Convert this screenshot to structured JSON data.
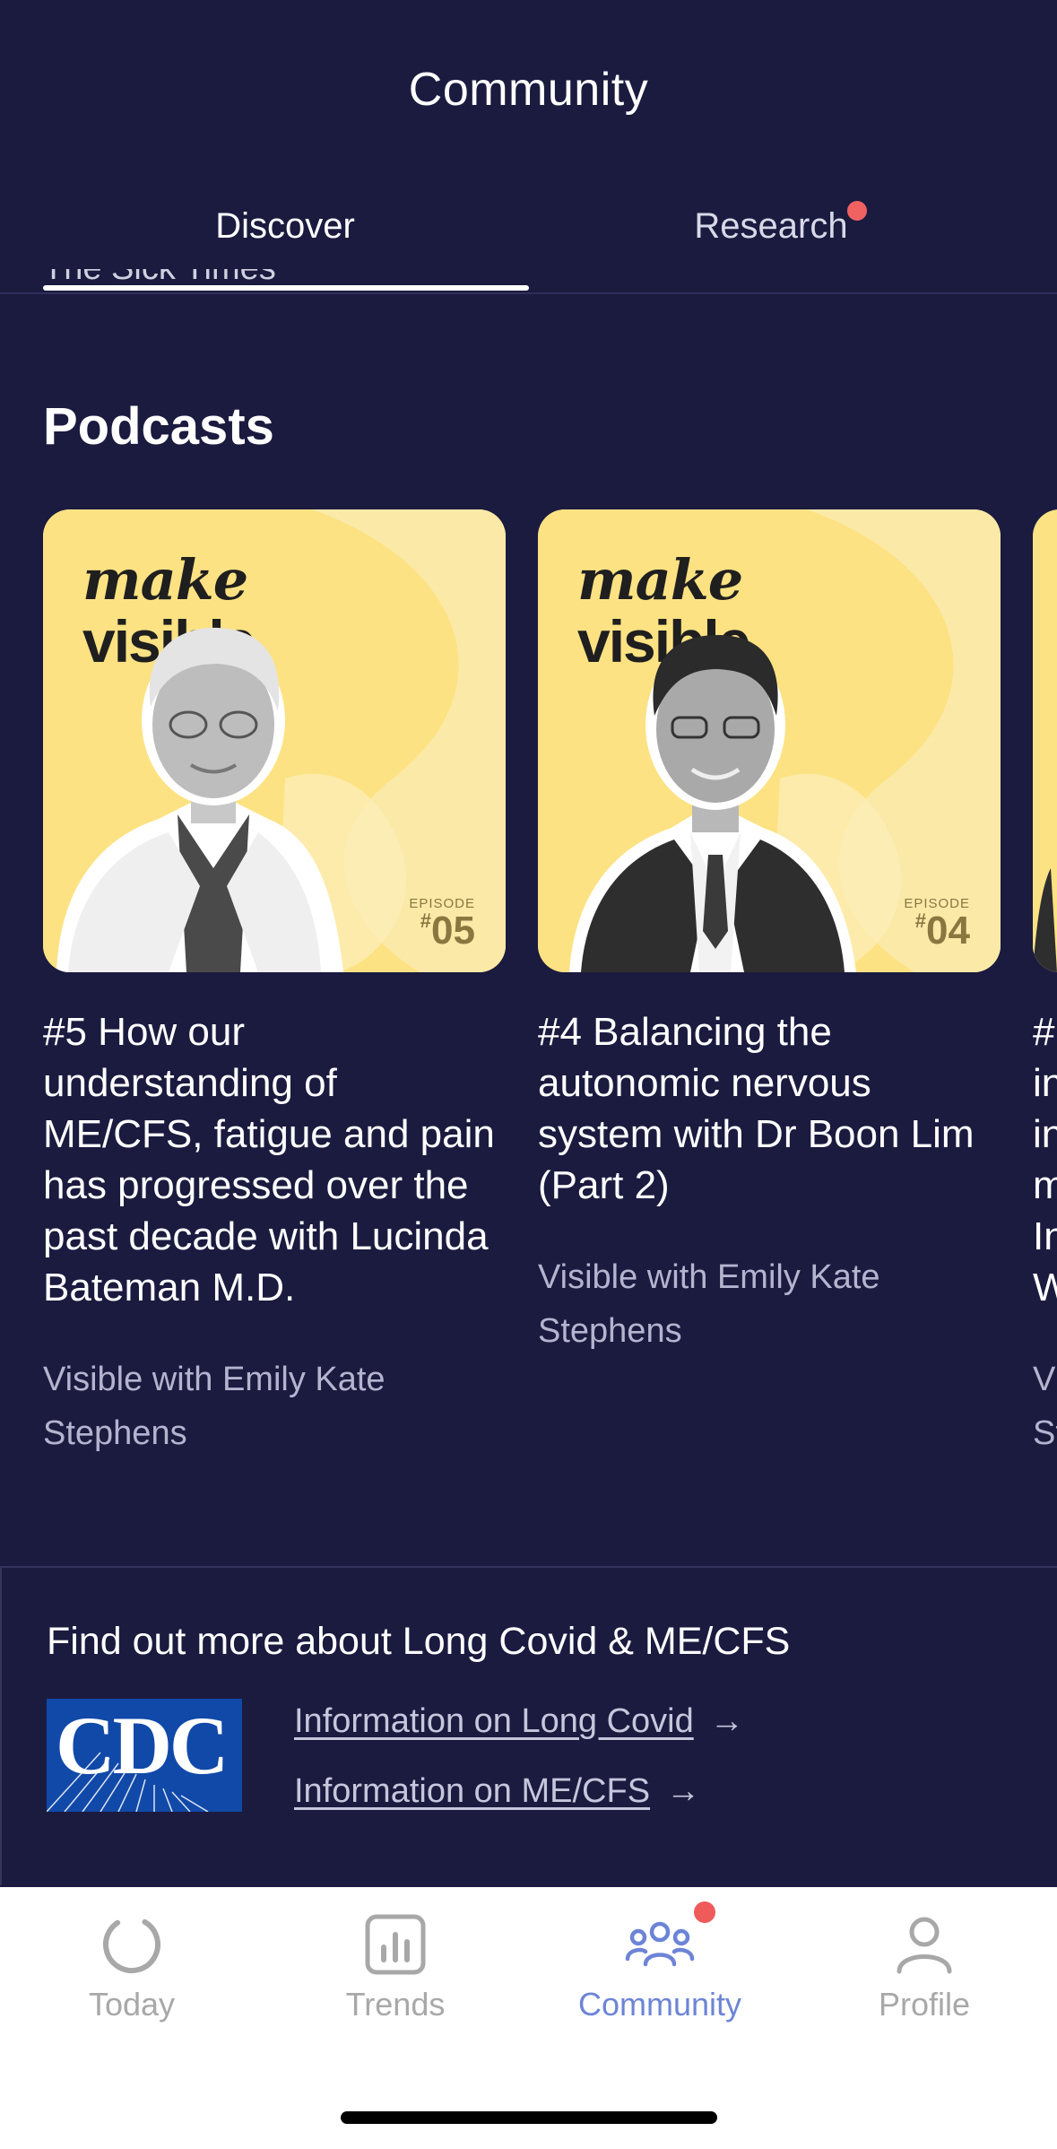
{
  "header": {
    "title": "Community"
  },
  "tabs": [
    {
      "label": "Discover",
      "active": true
    },
    {
      "label": "Research",
      "has_notification": true
    }
  ],
  "cut_off_text": "The Sick Times",
  "podcasts": {
    "section_title": "Podcasts",
    "items": [
      {
        "brand_line1": "make",
        "brand_line2": "visible.",
        "episode_label": "EPISODE",
        "episode_number": "05",
        "title": "#5 How our understanding of ME/CFS, fatigue and pain has progressed over the past decade with Lucinda Bateman M.D.",
        "author": "Visible with Emily Kate Stephens"
      },
      {
        "brand_line1": "make",
        "brand_line2": "visible.",
        "episode_label": "EPISODE",
        "episode_number": "04",
        "title": "#4 Balancing the autonomic nervous system with Dr Boon Lim (Part 2)",
        "author": "Visible with Emily Kate Stephens"
      },
      {
        "title_fragment": "#\nin\nin\nm\nIn\nW",
        "author_fragment": "V\nSt"
      }
    ]
  },
  "info": {
    "title": "Find out more about Long Covid & ME/CFS",
    "logo_text": "CDC",
    "links": [
      {
        "label": "Information on Long Covid",
        "arrow": "→"
      },
      {
        "label": "Information on ME/CFS",
        "arrow": "→"
      }
    ]
  },
  "bottom_nav": {
    "items": [
      {
        "label": "Today",
        "icon": "today-ring-icon"
      },
      {
        "label": "Trends",
        "icon": "trends-chart-icon"
      },
      {
        "label": "Community",
        "icon": "community-people-icon",
        "active": true,
        "has_notification": true
      },
      {
        "label": "Profile",
        "icon": "profile-person-icon"
      }
    ]
  },
  "colors": {
    "background": "#1b1b40",
    "cover_yellow": "#fde283",
    "accent_blue": "#6d84d6",
    "notification_red": "#f06262",
    "cdc_blue": "#1149a8"
  }
}
